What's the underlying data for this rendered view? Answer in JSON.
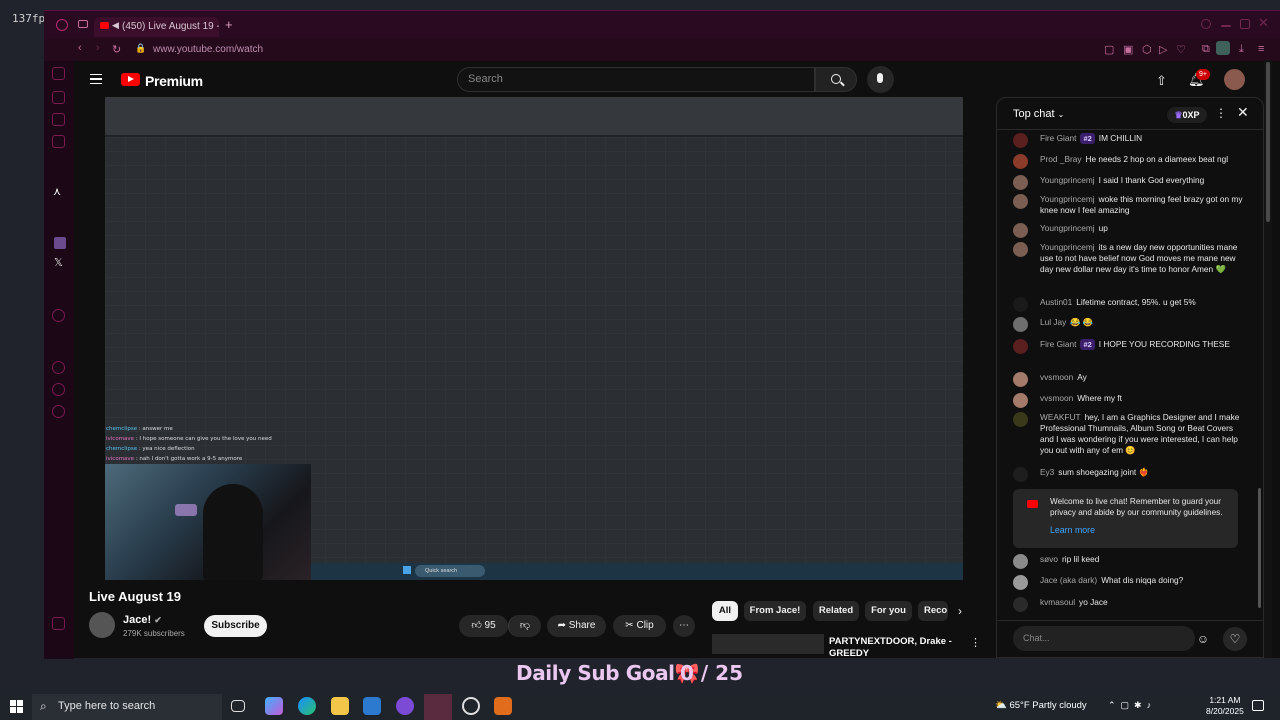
{
  "overlay": {
    "fps": "137fp",
    "sub_goal_label": "Daily Sub Goal🎀",
    "sub_goal_count": "0 / 25"
  },
  "browser": {
    "tab_title": "(450) Live August 19 -",
    "new_tab": "+",
    "url": "www.youtube.com/watch"
  },
  "youtube": {
    "brand": "Premium",
    "search_placeholder": "Search",
    "notification_count": "9+"
  },
  "video": {
    "title": "Live August 19",
    "channel_name": "Jace!",
    "subscribers": "279K subscribers",
    "subscribe_label": "Subscribe",
    "like_count": "95",
    "share_label": "Share",
    "clip_label": "Clip",
    "stream_chat": [
      {
        "user": "chemclipse",
        "text": ": answer me"
      },
      {
        "user": "ivicomave",
        "text": ": I hope someone can give you the love you need"
      },
      {
        "user": "chemclipse",
        "text": ": yea nice deflection"
      },
      {
        "user": "ivicomave",
        "text": ": nah I don't gotta work a 9-5 anymore"
      }
    ],
    "mini_search": "Quick search"
  },
  "recommendations": {
    "chips": [
      "All",
      "From Jace!",
      "Related",
      "For you",
      "Reco"
    ],
    "first_title": "PARTYNEXTDOOR, Drake - GREEDY"
  },
  "live_chat": {
    "header": "Top chat",
    "xp": "0XP",
    "messages": [
      {
        "author": "Fire Giant",
        "badge": "#2",
        "text": "IM CHILLIN",
        "avatar_color": "#5a1f1f"
      },
      {
        "author": "Prod _Bray",
        "badge": "",
        "text": "He needs 2 hop on a diameex beat ngl",
        "avatar_color": "#8a3b2a"
      },
      {
        "author": "Youngprincemj",
        "badge": "",
        "text": "I said I thank God everything",
        "avatar_color": "#7a5e52"
      },
      {
        "author": "Youngprincemj",
        "badge": "",
        "text": "woke this morning feel brazy got on my knee now I feel amazing",
        "avatar_color": "#7a5e52"
      },
      {
        "author": "Youngprincemj",
        "badge": "",
        "text": "up",
        "avatar_color": "#7a5e52"
      },
      {
        "author": "Youngprincemj",
        "badge": "",
        "text": "its a new day new opportunities mane use to not have belief now God moves me mane new day new dollar new day it's time to honor Amen 💚",
        "avatar_color": "#7a5e52"
      },
      {
        "author": "Austin01",
        "badge": "",
        "text": "Lifetime contract, 95%. u get 5%",
        "avatar_color": "#1a1a1a"
      },
      {
        "author": "Lul Jay",
        "badge": "",
        "text": "😂 😂",
        "avatar_color": "#6e6e6e"
      },
      {
        "author": "Fire Giant",
        "badge": "#2",
        "text": "I HOPE YOU RECORDING THESE",
        "avatar_color": "#5a1f1f"
      },
      {
        "author": "vvsmoon",
        "badge": "",
        "text": "Ay",
        "avatar_color": "#a47a6a"
      },
      {
        "author": "vvsmoon",
        "badge": "",
        "text": "Where my ft",
        "avatar_color": "#a47a6a"
      },
      {
        "author": "WEAKFUT",
        "badge": "",
        "text": "hey, I am a Graphics Designer and I make Professional Thumnails, Album Song or Beat Covers and I was wondering if you were interested, I can help you out with any of em 😊",
        "avatar_color": "#3a3a1a"
      },
      {
        "author": "Ey3",
        "badge": "",
        "text": "sum shoegazing joint ❤️‍🔥",
        "avatar_color": "#1e1e1e"
      },
      {
        "author": "søvo",
        "badge": "",
        "text": "rip lil keed",
        "avatar_color": "#8a8a8a"
      },
      {
        "author": "Jace (aka dark)",
        "badge": "",
        "text": "What dis niqqa doing?",
        "avatar_color": "#9a9a9a"
      },
      {
        "author": "kvmasoul",
        "badge": "",
        "text": "yo Jace",
        "avatar_color": "#2a2a2a"
      }
    ],
    "welcome": "Welcome to live chat! Remember to guard your privacy and abide by our community guidelines.",
    "learn_more": "Learn more",
    "input_placeholder": "Chat..."
  },
  "taskbar": {
    "search_placeholder": "Type here to search",
    "temperature": "65°F",
    "weather": "Partly cloudy",
    "time": "1:21 AM",
    "date": "8/20/2025"
  }
}
